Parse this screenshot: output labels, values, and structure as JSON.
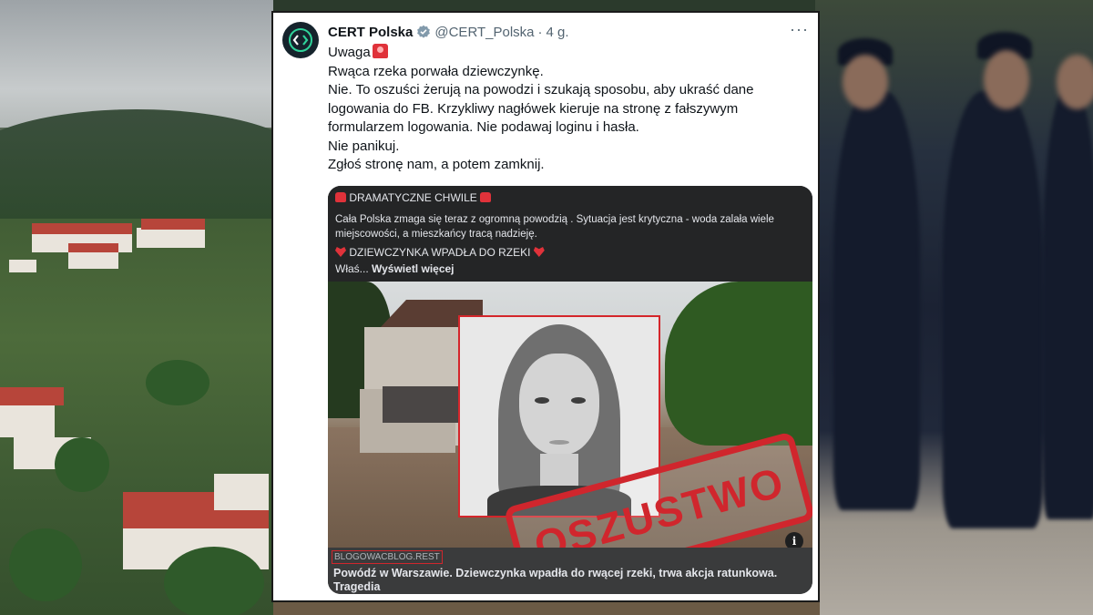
{
  "tweet": {
    "author": "CERT Polska",
    "handle": "@CERT_Polska",
    "separator": "·",
    "time": "4 g.",
    "more_label": "···",
    "lines": {
      "l1": "Uwaga",
      "l2": "Rwąca rzeka porwała dziewczynkę.",
      "l3": "Nie. To oszuści żerują na powodzi i szukają sposobu, aby ukraść dane logowania do FB.  Krzykliwy nagłówek kieruje na stronę z fałszywym formularzem logowania. Nie podawaj loginu i hasła.",
      "l4": "Nie panikuj.",
      "l5": "Zgłoś stronę nam, a potem zamknij."
    }
  },
  "embed": {
    "heading": " DRAMATYCZNE CHWILE ",
    "body": "Cała Polska zmaga się teraz z ogromną powodzią . Sytuacja jest krytyczna - woda zalała wiele miejscowości, a mieszkańcy tracą nadzieję.",
    "heading2": " DZIEWCZYNKA WPADŁA DO RZEKI ",
    "truncated_prefix": "Właś... ",
    "see_more": "Wyświetl więcej",
    "stamp_text": "OSZUSTWO",
    "info_label": "i",
    "domain": "BLOGOWACBLOG.REST",
    "headline": "Powódź w Warszawie. Dziewczynka wpadła do rwącej rzeki, trwa akcja ratunkowa. Tragedia"
  },
  "colors": {
    "stamp": "#d0262d",
    "verified": "#829aab",
    "fb_background": "#242526"
  },
  "icons": {
    "avatar": "cert-logo-icon",
    "verified": "verified-badge-icon",
    "more": "more-options-icon",
    "info": "info-icon"
  }
}
